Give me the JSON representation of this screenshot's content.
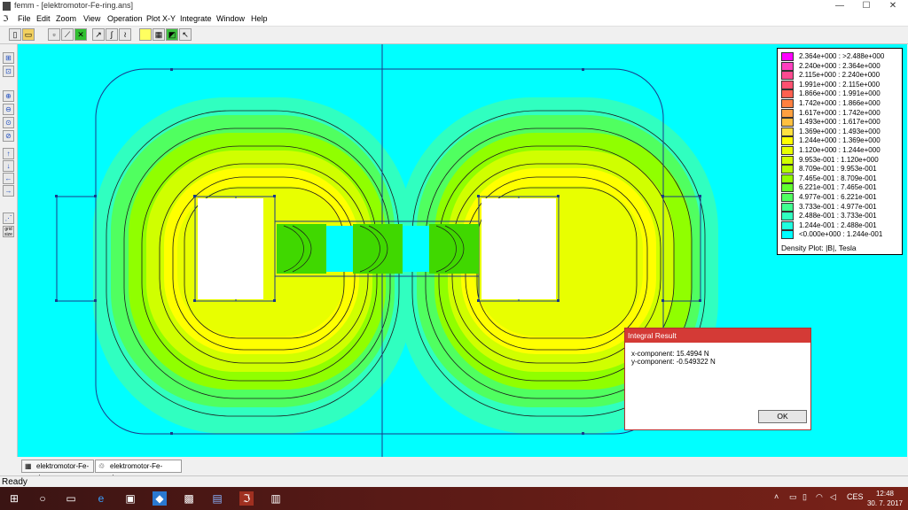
{
  "window": {
    "title": "femm - [elektromotor-Fe-ring.ans]",
    "controls": {
      "minimize": "—",
      "maximize": "☐",
      "close": "✕"
    }
  },
  "menu": [
    "File",
    "Edit",
    "Zoom",
    "View",
    "Operation",
    "Plot X-Y",
    "Integrate",
    "Window",
    "Help"
  ],
  "toolbar_icons": [
    "new-file-icon",
    "open-file-icon",
    "point-mode-icon",
    "contour-mode-icon",
    "area-mode-icon",
    "plot-icon",
    "integrate-icon",
    "vector-icon",
    "density-icon",
    "show-mesh-icon",
    "colour-map-icon",
    "arrow-icon"
  ],
  "left_toolbar_icons": [
    "snap-icon",
    "zoom-in-icon",
    "zoom-out-icon",
    "zoom-natural-icon",
    "zoom-window-icon",
    "pan-up-icon",
    "pan-down-icon",
    "pan-left-icon",
    "pan-right-icon",
    "grid-icon"
  ],
  "left_toolbar": {
    "grid_label": "grid size"
  },
  "legend": {
    "entries": [
      {
        "range": "2.364e+000 : >2.488e+000",
        "color": "#ff00ff"
      },
      {
        "range": "2.240e+000 : 2.364e+000",
        "color": "#ff40c0"
      },
      {
        "range": "2.115e+000 : 2.240e+000",
        "color": "#ff4a90"
      },
      {
        "range": "1.991e+000 : 2.115e+000",
        "color": "#ff5070"
      },
      {
        "range": "1.866e+000 : 1.991e+000",
        "color": "#ff6050"
      },
      {
        "range": "1.742e+000 : 1.866e+000",
        "color": "#ff8040"
      },
      {
        "range": "1.617e+000 : 1.742e+000",
        "color": "#ffa040"
      },
      {
        "range": "1.493e+000 : 1.617e+000",
        "color": "#ffc040"
      },
      {
        "range": "1.369e+000 : 1.493e+000",
        "color": "#ffe040"
      },
      {
        "range": "1.244e+000 : 1.369e+000",
        "color": "#ffff00"
      },
      {
        "range": "1.120e+000 : 1.244e+000",
        "color": "#e8ff00"
      },
      {
        "range": "9.953e-001 : 1.120e+000",
        "color": "#d0ff00"
      },
      {
        "range": "8.709e-001 : 9.953e-001",
        "color": "#b0ff00"
      },
      {
        "range": "7.465e-001 : 8.709e-001",
        "color": "#90ff00"
      },
      {
        "range": "6.221e-001 : 7.465e-001",
        "color": "#60ff30"
      },
      {
        "range": "4.977e-001 : 6.221e-001",
        "color": "#50ff60"
      },
      {
        "range": "3.733e-001 : 4.977e-001",
        "color": "#40ff90"
      },
      {
        "range": "2.488e-001 : 3.733e-001",
        "color": "#30ffc0"
      },
      {
        "range": "1.244e-001 : 2.488e-001",
        "color": "#20ffe0"
      },
      {
        "range": "<0.000e+000 : 1.244e-001",
        "color": "#00ffff"
      }
    ],
    "title": "Density Plot: |B|, Tesla"
  },
  "dialog": {
    "title": "Integral Result",
    "x_line": "x-component: 15.4994 N",
    "y_line": "y-component: -0.549322 N",
    "ok_label": "OK"
  },
  "tabs": [
    {
      "label": "elektromotor-Fe-ring",
      "icon": "document-icon"
    },
    {
      "label": "elektromotor-Fe-ring.ans",
      "icon": "solution-icon"
    }
  ],
  "status": "Ready",
  "taskbar": {
    "icons": [
      "windows-start-icon",
      "search-icon",
      "task-view-icon",
      "edge-browser-icon",
      "store-icon",
      "dropbox-icon",
      "app-icon",
      "save-icon",
      "femm-icon",
      "files-icon"
    ],
    "tray": {
      "language": "CES",
      "time": "12:48",
      "date": "30. 7. 2017"
    }
  },
  "colors": {
    "canvas": "#00ffff",
    "dialog_title": "#d43a36",
    "taskbar": "#5a1a16"
  }
}
